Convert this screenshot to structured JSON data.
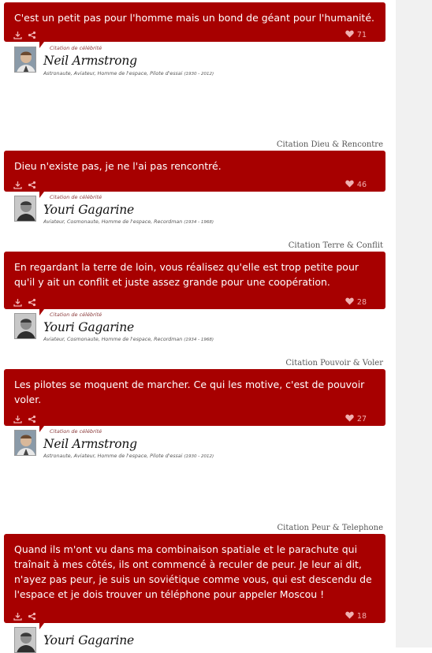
{
  "quotes": [
    {
      "category": "",
      "text": "C'est un petit pas pour l'homme mais un bond de géant pour l'humanité.",
      "likes": "71",
      "celeb_label": "Citation de célébrité",
      "author": "Neil Armstrong",
      "description": "Astronaute, Aviateur, Homme de l'espace, Pilote d'essai",
      "years": "(1930 - 2012)",
      "avatar": "neil"
    },
    {
      "category": "Citation Dieu & Rencontre",
      "text": "Dieu n'existe pas, je ne l'ai pas rencontré.",
      "likes": "46",
      "celeb_label": "Citation de célébrité",
      "author": "Youri Gagarine",
      "description": "Aviateur, Cosmonaute, Homme de l'espace, Recordman",
      "years": "(1934 - 1968)",
      "avatar": "youri"
    },
    {
      "category": "Citation Terre & Conflit",
      "text": "En regardant la terre de loin, vous réalisez qu'elle est trop petite pour qu'il y ait un conflit et juste assez grande pour une coopération.",
      "likes": "28",
      "celeb_label": "Citation de célébrité",
      "author": "Youri Gagarine",
      "description": "Aviateur, Cosmonaute, Homme de l'espace, Recordman",
      "years": "(1934 - 1968)",
      "avatar": "youri"
    },
    {
      "category": "Citation Pouvoir & Voler",
      "text": "Les pilotes se moquent de marcher. Ce qui les motive, c'est de pouvoir voler.",
      "likes": "27",
      "celeb_label": "Citation de célébrité",
      "author": "Neil Armstrong",
      "description": "Astronaute, Aviateur, Homme de l'espace, Pilote d'essai",
      "years": "(1930 - 2012)",
      "avatar": "neil"
    },
    {
      "category": "Citation Peur & Telephone",
      "text": "Quand ils m'ont vu dans ma combinaison spatiale et le parachute qui traînait à mes côtés, ils ont commencé à reculer de peur. Je leur ai dit, n'ayez pas peur, je suis un soviétique comme vous, qui est descendu de l'espace et je dois trouver un téléphone pour appeler Moscou !",
      "likes": "18",
      "celeb_label": "",
      "author": "Youri Gagarine",
      "description": "",
      "years": "",
      "avatar": "youri"
    }
  ],
  "colors": {
    "quote_box": "#a70000",
    "heart": "#f0b0b0",
    "gutter": "#f1f1f1"
  },
  "icons": [
    "download-icon",
    "share-icon",
    "heart-icon"
  ]
}
